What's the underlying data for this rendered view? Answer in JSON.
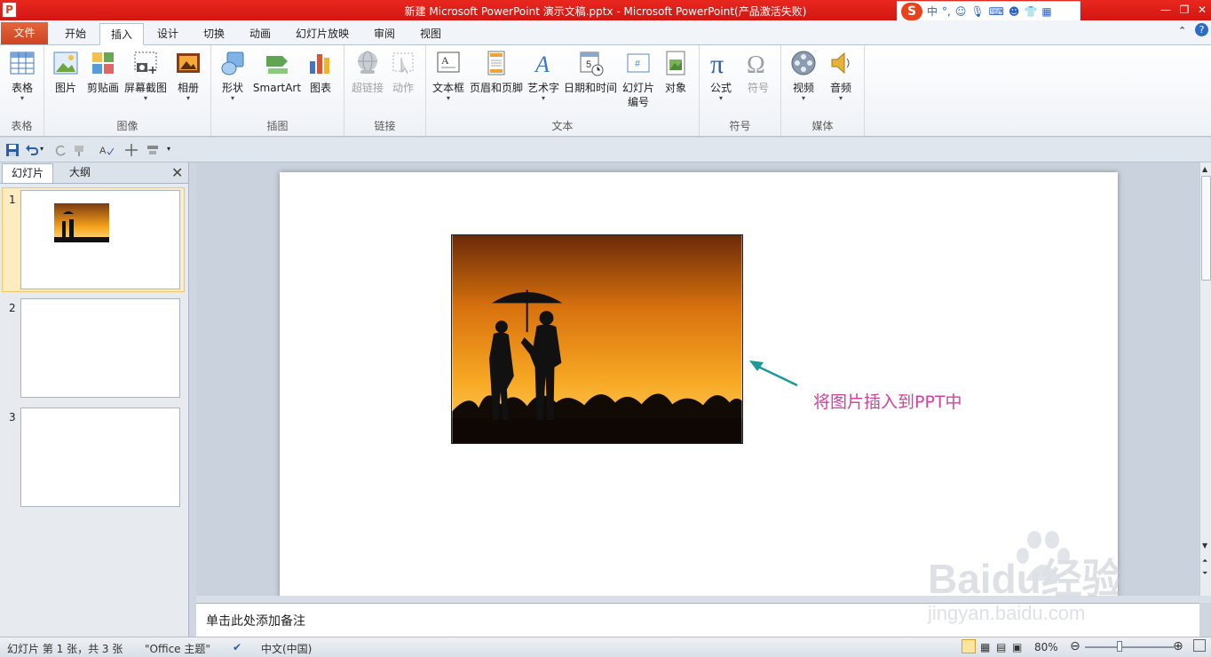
{
  "window": {
    "title": "新建 Microsoft PowerPoint 演示文稿.pptx - Microsoft PowerPoint(产品激活失败)",
    "app_icon": "P"
  },
  "ime": {
    "mode": "中",
    "punct": "°,"
  },
  "tabs": [
    {
      "label": "文件"
    },
    {
      "label": "开始"
    },
    {
      "label": "插入"
    },
    {
      "label": "设计"
    },
    {
      "label": "切换"
    },
    {
      "label": "动画"
    },
    {
      "label": "幻灯片放映"
    },
    {
      "label": "审阅"
    },
    {
      "label": "视图"
    }
  ],
  "active_tab": "插入",
  "ribbon": {
    "groups": [
      {
        "label": "表格",
        "buttons": [
          "表格"
        ]
      },
      {
        "label": "图像",
        "buttons": [
          "图片",
          "剪贴画",
          "屏幕截图",
          "相册"
        ]
      },
      {
        "label": "插图",
        "buttons": [
          "形状",
          "SmartArt",
          "图表"
        ]
      },
      {
        "label": "链接",
        "buttons": [
          "超链接",
          "动作"
        ]
      },
      {
        "label": "文本",
        "buttons": [
          "文本框",
          "页眉和页脚",
          "艺术字",
          "日期和时间",
          "幻灯片",
          "对象"
        ],
        "extra": "编号"
      },
      {
        "label": "符号",
        "buttons": [
          "公式",
          "符号"
        ]
      },
      {
        "label": "媒体",
        "buttons": [
          "视频",
          "音频"
        ]
      }
    ]
  },
  "left_pane": {
    "tabs": [
      "幻灯片",
      "大纲"
    ],
    "slides": [
      "1",
      "2",
      "3"
    ],
    "selected": "1"
  },
  "slide": {
    "annotation": "将图片插入到PPT中"
  },
  "notes": {
    "placeholder": "单击此处添加备注"
  },
  "status": {
    "slide_info": "幻灯片 第 1 张，共 3 张",
    "theme": "\"Office 主题\"",
    "language": "中文(中国)",
    "zoom": "80%",
    "zoom_level": 0.8
  },
  "watermark": {
    "text": "Baidu经验",
    "url": "jingyan.baidu.com"
  },
  "colors": {
    "title_bar": "#d31611",
    "file_tab": "#cc4420",
    "annotation": "#d4409b",
    "arrow": "#1a9a9a"
  }
}
